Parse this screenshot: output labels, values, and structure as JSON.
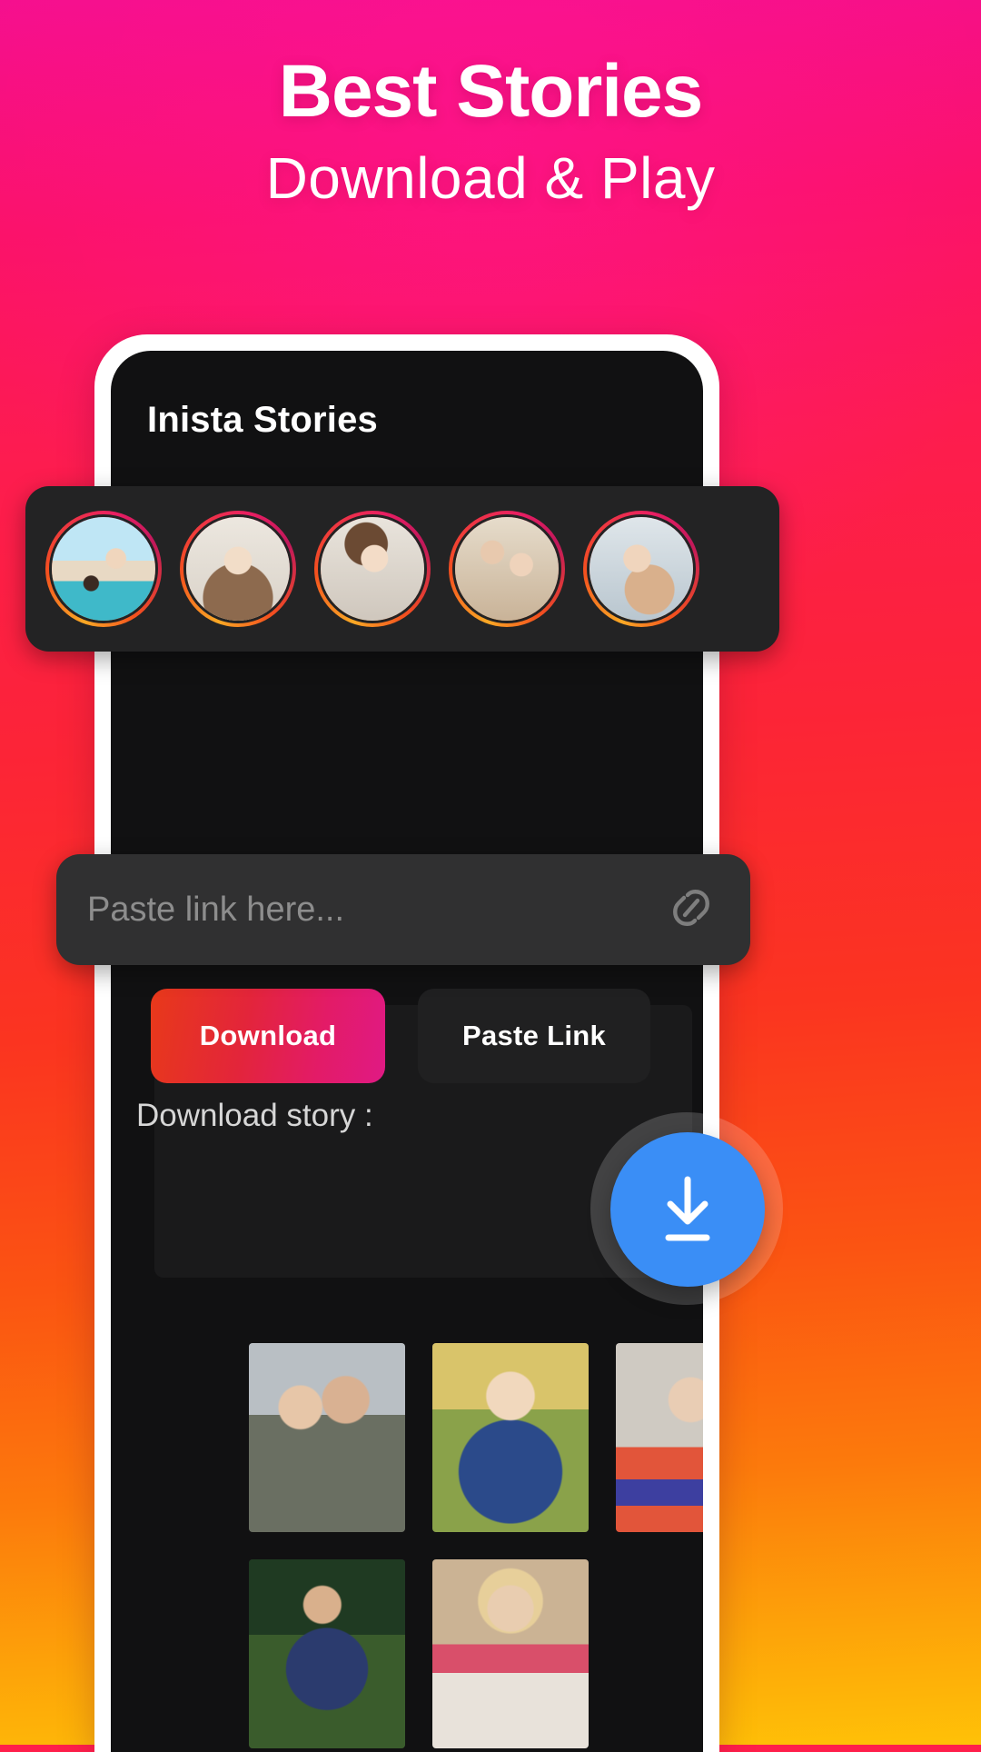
{
  "hero": {
    "title": "Best Stories",
    "subtitle": "Download & Play"
  },
  "colors": {
    "bg_top": "#f50f8e",
    "bg_mid": "#fb3420",
    "bg_bottom": "#ffc107",
    "accent_download": "#e31b67",
    "fab_blue": "#3a8ef6",
    "screen_bg": "#111112",
    "card_bg": "#232324",
    "field_bg": "#303031",
    "placeholder_text": "#8d8d8d"
  },
  "phone": {
    "app_title": "Inista Stories",
    "stories": {
      "label": "story-avatars",
      "items": [
        {
          "name": "story-1",
          "alt": "couple at the beach"
        },
        {
          "name": "story-2",
          "alt": "woman with long hair"
        },
        {
          "name": "story-3",
          "alt": "woman in white dress"
        },
        {
          "name": "story-4",
          "alt": "couple embracing"
        },
        {
          "name": "story-5",
          "alt": "woman in floral dress"
        }
      ]
    },
    "link_input": {
      "placeholder": "Paste link here...",
      "value": "",
      "icon": "chain-link-icon"
    },
    "buttons": {
      "download": "Download",
      "paste_link": "Paste Link"
    },
    "section": {
      "label": "Download story :",
      "thumbnails": [
        {
          "name": "thumb-1",
          "alt": "couple dancing outdoors"
        },
        {
          "name": "thumb-2",
          "alt": "woman in floral dress outdoors"
        },
        {
          "name": "thumb-3",
          "alt": "woman in striped sweater"
        },
        {
          "name": "thumb-4",
          "alt": "man in blue suit"
        },
        {
          "name": "thumb-5",
          "alt": "woman in straw hat"
        }
      ]
    },
    "fab": {
      "icon": "download-arrow-icon",
      "label": "Download"
    }
  }
}
